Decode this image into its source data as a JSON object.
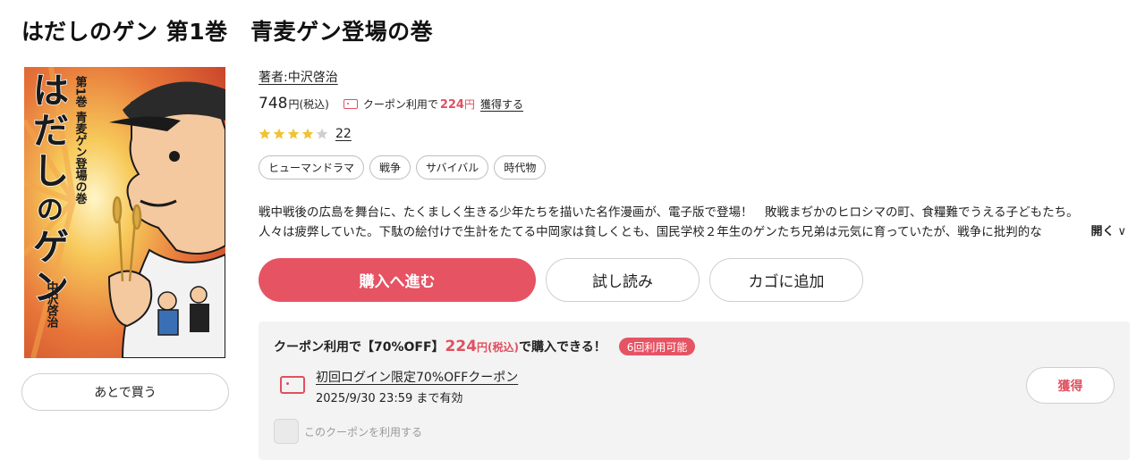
{
  "page": {
    "title": "はだしのゲン 第1巻　青麦ゲン登場の巻"
  },
  "cover": {
    "alt": "はだしのゲン 第1巻",
    "vertical_title": "はだしのゲン",
    "volume_caption": "第1巻 青麦ゲン登場の巻",
    "author_caption": "中沢啓治"
  },
  "later_button_label": "あとで買う",
  "info": {
    "author_label": "著者:中沢啓治",
    "price": "748",
    "price_unit": "円(税込)",
    "coupon_text": "クーポン利用で",
    "coupon_price": "224",
    "coupon_unit": "円",
    "get_coupon_link": "獲得する",
    "rating": 4,
    "rating_max": 5,
    "review_count": "22",
    "tags": [
      "ヒューマンドラマ",
      "戦争",
      "サバイバル",
      "時代物"
    ],
    "description_line1": "戦中戦後の広島を舞台に、たくましく生きる少年たちを描いた名作漫画が、電子版で登場！　敗戦まぢかのヒロシマの町、食糧難でうえる子どもたち。",
    "description_line2": "人々は疲弊していた。下駄の絵付けで生計をたてる中岡家は貧しくとも、国民学校２年生のゲンたち兄弟は元気に育っていたが、戦争に批判的な",
    "open_label": "開く",
    "open_chevron": "∨"
  },
  "actions": {
    "buy_label": "購入へ進む",
    "trial_label": "試し読み",
    "cart_label": "カゴに追加"
  },
  "coupon_box": {
    "head_prefix": "クーポン利用で【70%OFF】",
    "head_price": "224",
    "head_unit": "円(税込)",
    "head_suffix": "で購入できる！",
    "badge": "6回利用可能",
    "name": "初回ログイン限定70%OFFクーポン",
    "expiry": "2025/9/30 23:59 まで有効",
    "get_label": "獲得",
    "checkbox_label": "このクーポンを利用する"
  },
  "colors": {
    "accent": "#e65363",
    "coupon_red": "#e0505f",
    "star": "#f2c233",
    "star_empty": "#cfcfcf",
    "box_bg": "#f3f3f3"
  }
}
